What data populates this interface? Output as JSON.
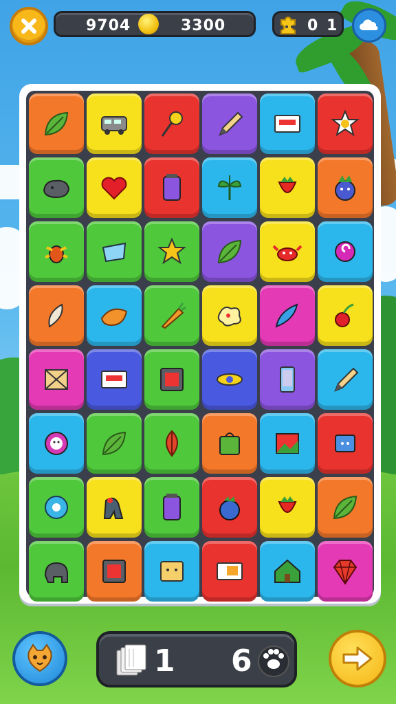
{
  "header": {
    "score_left": "9704",
    "score_right": "3300",
    "gem_count_a": "0",
    "gem_count_b": "1"
  },
  "footer": {
    "cards_count": "1",
    "paw_count": "6"
  },
  "colors": {
    "orange": "#f4782a",
    "yellow": "#f7e01c",
    "red": "#e8332f",
    "purple": "#8b55e0",
    "cyan": "#2cb7ec",
    "green": "#4fc83b",
    "magenta": "#e53ab5",
    "blue": "#4a5ae0"
  },
  "board": {
    "rows": [
      [
        {
          "color": "orange",
          "icon": "leaf-icon"
        },
        {
          "color": "yellow",
          "icon": "van-icon"
        },
        {
          "color": "red",
          "icon": "lollipop-icon"
        },
        {
          "color": "purple",
          "icon": "pencil-icon"
        },
        {
          "color": "cyan",
          "icon": "card-icon"
        },
        {
          "color": "red",
          "icon": "star-flower-icon"
        }
      ],
      [
        {
          "color": "green",
          "icon": "rock-icon"
        },
        {
          "color": "yellow",
          "icon": "heart-icon"
        },
        {
          "color": "red",
          "icon": "jar-icon"
        },
        {
          "color": "cyan",
          "icon": "plant-icon"
        },
        {
          "color": "yellow",
          "icon": "strawberry-icon"
        },
        {
          "color": "orange",
          "icon": "berry-creature-icon"
        }
      ],
      [
        {
          "color": "green",
          "icon": "bug-icon"
        },
        {
          "color": "green",
          "icon": "cup-icon"
        },
        {
          "color": "green",
          "icon": "star-creature-icon"
        },
        {
          "color": "purple",
          "icon": "leaf-icon"
        },
        {
          "color": "yellow",
          "icon": "crab-icon"
        },
        {
          "color": "cyan",
          "icon": "swirl-icon"
        }
      ],
      [
        {
          "color": "orange",
          "icon": "feather-icon"
        },
        {
          "color": "cyan",
          "icon": "bun-icon"
        },
        {
          "color": "green",
          "icon": "carrot-icon"
        },
        {
          "color": "yellow",
          "icon": "splat-icon"
        },
        {
          "color": "magenta",
          "icon": "fish-icon"
        },
        {
          "color": "yellow",
          "icon": "cherry-icon"
        }
      ],
      [
        {
          "color": "magenta",
          "icon": "envelope-icon"
        },
        {
          "color": "blue",
          "icon": "card-icon"
        },
        {
          "color": "green",
          "icon": "frame-icon"
        },
        {
          "color": "blue",
          "icon": "planet-icon"
        },
        {
          "color": "purple",
          "icon": "phone-icon"
        },
        {
          "color": "cyan",
          "icon": "pencil-icon"
        }
      ],
      [
        {
          "color": "cyan",
          "icon": "flower-face-icon"
        },
        {
          "color": "green",
          "icon": "leaf-icon"
        },
        {
          "color": "green",
          "icon": "red-leaf-icon"
        },
        {
          "color": "orange",
          "icon": "bag-icon"
        },
        {
          "color": "cyan",
          "icon": "picture-icon"
        },
        {
          "color": "red",
          "icon": "box-face-icon"
        }
      ],
      [
        {
          "color": "green",
          "icon": "gear-flower-icon"
        },
        {
          "color": "yellow",
          "icon": "creature-icon"
        },
        {
          "color": "green",
          "icon": "jar-icon"
        },
        {
          "color": "red",
          "icon": "blueberry-icon"
        },
        {
          "color": "yellow",
          "icon": "strawberry-icon"
        },
        {
          "color": "orange",
          "icon": "leaf-icon"
        }
      ],
      [
        {
          "color": "green",
          "icon": "elephant-icon"
        },
        {
          "color": "orange",
          "icon": "frame-icon"
        },
        {
          "color": "cyan",
          "icon": "cracker-icon"
        },
        {
          "color": "red",
          "icon": "ticket-icon"
        },
        {
          "color": "cyan",
          "icon": "house-icon"
        },
        {
          "color": "magenta",
          "icon": "gem-icon"
        }
      ]
    ]
  }
}
